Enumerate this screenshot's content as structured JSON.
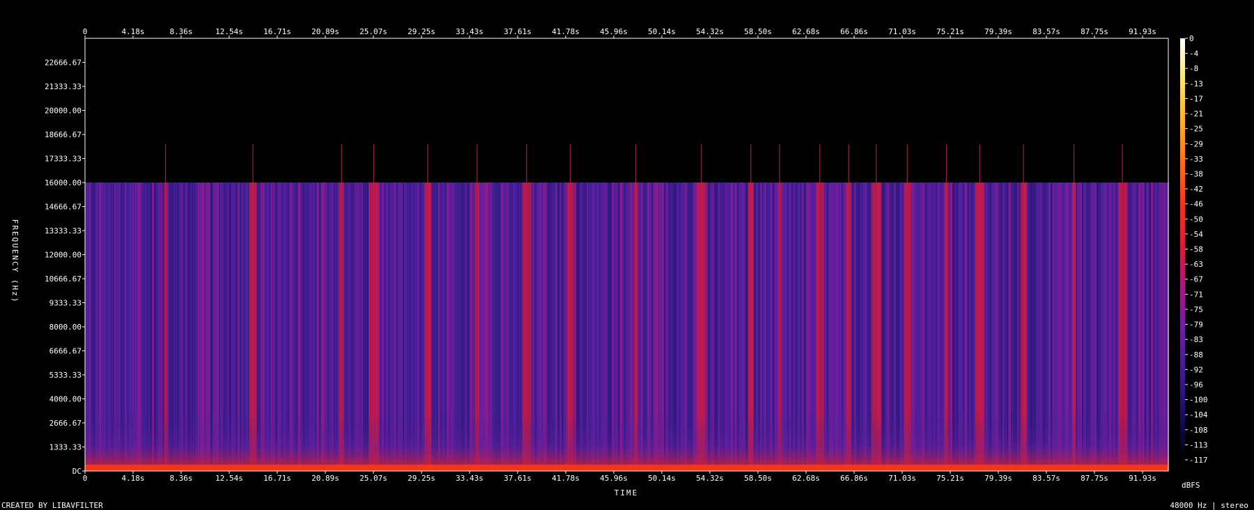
{
  "chart_data": {
    "type": "heatmap",
    "title": "",
    "xlabel": "TIME",
    "ylabel": "FREQUENCY (Hz)",
    "x_ticks": [
      "0",
      "4.18s",
      "8.36s",
      "12.54s",
      "16.71s",
      "20.89s",
      "25.07s",
      "29.25s",
      "33.43s",
      "37.61s",
      "41.78s",
      "45.96s",
      "50.14s",
      "54.32s",
      "58.50s",
      "62.68s",
      "66.86s",
      "71.03s",
      "75.21s",
      "79.39s",
      "83.57s",
      "87.75s",
      "91.93s"
    ],
    "y_ticks": [
      "DC",
      "1333.33",
      "2666.67",
      "4000.00",
      "5333.33",
      "6666.67",
      "8000.00",
      "9333.33",
      "10666.67",
      "12000.00",
      "13333.33",
      "14666.67",
      "16000.00",
      "17333.33",
      "18666.67",
      "20000.00",
      "21333.33",
      "22666.67"
    ],
    "xlim": [
      0,
      94.2
    ],
    "ylim": [
      0,
      24000
    ],
    "energy_cutoff_hz": 16000,
    "colorbar": {
      "unit": "dBFS",
      "ticks": [
        "0",
        "-4",
        "-8",
        "-13",
        "-17",
        "-21",
        "-25",
        "-29",
        "-33",
        "-38",
        "-42",
        "-46",
        "-50",
        "-54",
        "-58",
        "-63",
        "-67",
        "-71",
        "-75",
        "-79",
        "-83",
        "-88",
        "-92",
        "-96",
        "-100",
        "-104",
        "-108",
        "-113",
        "-117"
      ],
      "colors": [
        "#000000",
        "#1a0a5c",
        "#3d1a8f",
        "#6a1fa0",
        "#a0198a",
        "#d81b3a",
        "#f0331c",
        "#ff6a1a",
        "#ffae2a",
        "#ffe46a",
        "#ffffff"
      ]
    },
    "loud_segments_s": [
      7.0,
      14.6,
      22.3,
      25.1,
      29.8,
      34.1,
      38.4,
      42.2,
      47.9,
      53.6,
      57.9,
      60.4,
      63.9,
      66.4,
      68.8,
      71.5,
      74.9,
      77.8,
      81.6,
      86.0,
      90.2
    ]
  },
  "footer": {
    "created_by": "CREATED BY LIBAVFILTER",
    "format": "48000 Hz | stereo"
  }
}
